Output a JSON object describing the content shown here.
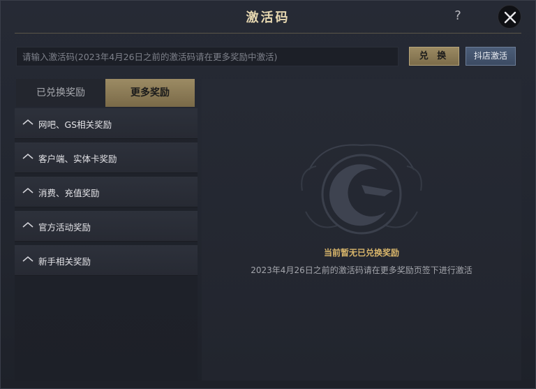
{
  "window": {
    "title": "激活码"
  },
  "icons": {
    "help": "help-icon",
    "close": "close-icon",
    "expand": "chevron-up-icon",
    "emblem": "crescent-emblem-icon"
  },
  "colors": {
    "gold": "#d9b66b",
    "accent": "#8c7b56",
    "blue": "#46566f"
  },
  "redeem": {
    "placeholder": "请输入激活码(2023年4月26日之前的激活码请在更多奖励中激活)",
    "value": "",
    "redeem_label": "兑 换",
    "shop_label": "抖店激活"
  },
  "tabs": [
    {
      "label": "已兑换奖励",
      "active": false
    },
    {
      "label": "更多奖励",
      "active": true
    }
  ],
  "sidebar": {
    "items": [
      {
        "label": "网吧、GS相关奖励"
      },
      {
        "label": "客户端、实体卡奖励"
      },
      {
        "label": "消费、充值奖励"
      },
      {
        "label": "官方活动奖励"
      },
      {
        "label": "新手相关奖励"
      }
    ]
  },
  "empty_state": {
    "title": "当前暂无已兑换奖励",
    "hint": "2023年4月26日之前的激活码请在更多奖励页签下进行激活"
  }
}
